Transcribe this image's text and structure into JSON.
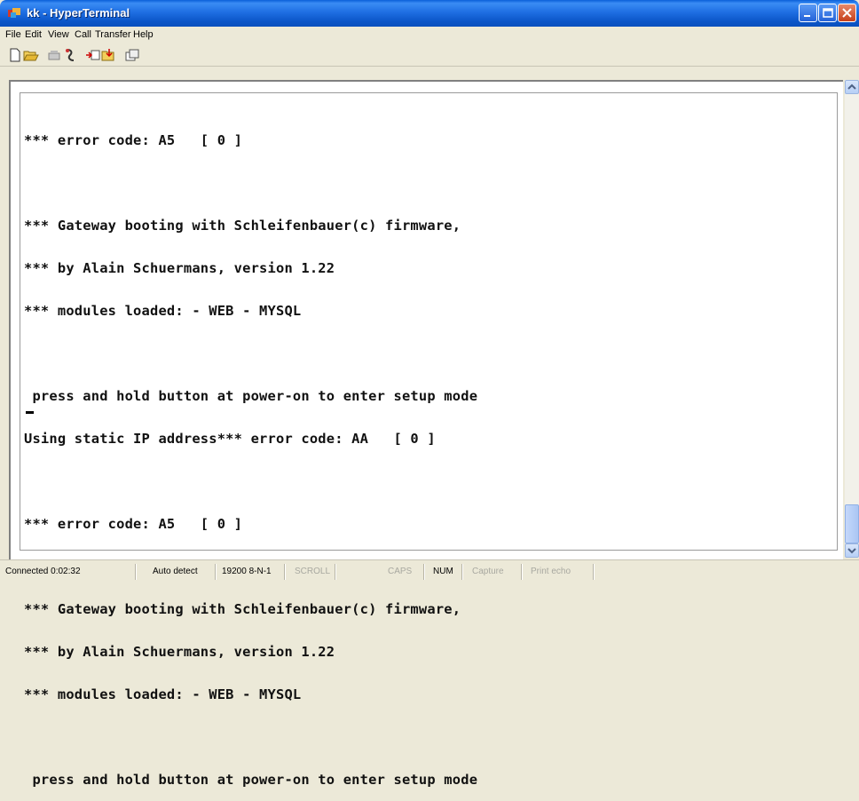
{
  "window": {
    "title": "kk - HyperTerminal"
  },
  "menu": {
    "items": [
      "File",
      "Edit",
      "View",
      "Call",
      "Transfer",
      "Help"
    ]
  },
  "toolbar": {
    "icons": [
      "new-icon",
      "open-icon",
      "call-icon",
      "disconnect-icon",
      "send-icon",
      "receive-icon",
      "properties-icon"
    ]
  },
  "terminal": {
    "lines": [
      "*** error code: A5   [ 0 ]",
      "",
      "*** Gateway booting with Schleifenbauer(c) firmware,",
      "*** by Alain Schuermans, version 1.22",
      "*** modules loaded: - WEB - MYSQL",
      "",
      " press and hold button at power-on to enter setup mode",
      "Using static IP address*** error code: AA   [ 0 ]",
      "",
      "*** error code: A5   [ 0 ]",
      "",
      "*** Gateway booting with Schleifenbauer(c) firmware,",
      "*** by Alain Schuermans, version 1.22",
      "*** modules loaded: - WEB - MYSQL",
      "",
      " press and hold button at power-on to enter setup mode"
    ]
  },
  "status": {
    "connected": "Connected 0:02:32",
    "detect": "Auto detect",
    "port": "19200 8-N-1",
    "scroll": "SCROLL",
    "caps": "CAPS",
    "num": "NUM",
    "capture": "Capture",
    "print_echo": "Print echo"
  }
}
